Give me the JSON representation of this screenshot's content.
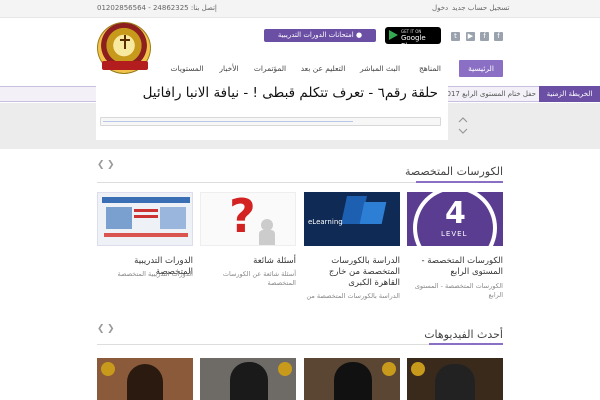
{
  "topbar": {
    "login": "دخول",
    "register": "تسجيل حساب جديد",
    "phone": "01202856564 - 24862325 :إتصل بنا"
  },
  "header": {
    "exam_button": "امتحانات الدورات التدريبية",
    "gplay_small": "GET IT ON",
    "gplay_big": "Google Play"
  },
  "nav": {
    "items": [
      "الرئيسية",
      "المناهج",
      "البث المباشر",
      "التعليم عن بعد",
      "المؤتمرات",
      "الأخبار",
      "المستويات"
    ]
  },
  "ticker": {
    "label": "الخريطة الزمنية",
    "text": "22 /4 /2017 حفل ختام المستوى الرابع"
  },
  "popup": {
    "title": "حلقة رقم٦ - تعرف تتكلم قبطى ! - نيافة الانبا رافائيل"
  },
  "courses": {
    "heading": "الكورسات المتخصصة",
    "cards": [
      {
        "title": "الكورسات المتخصصة - المستوى الرابع",
        "sub": "الكورسات المتخصصة - المستوى الرابع",
        "badge": "4",
        "badge_sub": "LEVEL"
      },
      {
        "title": "الدراسة بالكورسات المتخصصة من خارج القاهرة الكبرى",
        "sub": "الدراسة بالكورسات المتخصصة من",
        "badge": "eLearning"
      },
      {
        "title": "أسئلة شائعة",
        "sub": "أسئلة شائعة عن الكورسات المتخصصة",
        "badge": "?"
      },
      {
        "title": "الدورات التدريبية المتخصصة",
        "sub": "الدورات التدريبية المتخصصة",
        "badge": ""
      }
    ]
  },
  "videos": {
    "heading": "أحدث الفيديوهات"
  },
  "colors": {
    "accent": "#6b4fa4",
    "accent_light": "#8a6fc4"
  }
}
